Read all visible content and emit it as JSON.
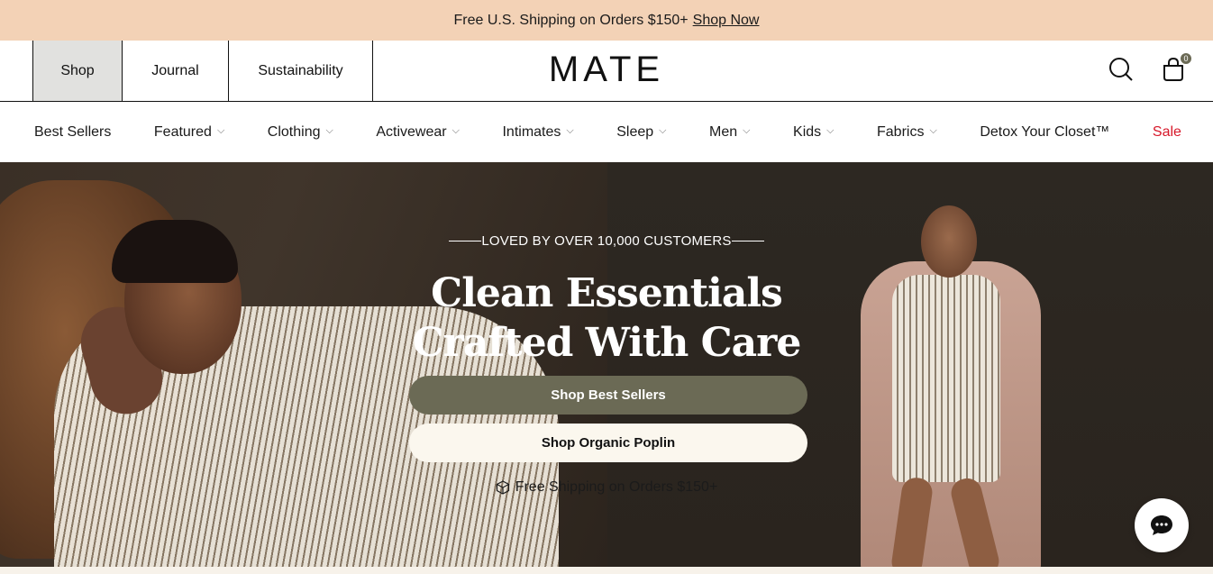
{
  "promo": {
    "text": "Free U.S. Shipping on Orders $150+",
    "link": "Shop Now"
  },
  "header": {
    "tabs": [
      "Shop",
      "Journal",
      "Sustainability"
    ],
    "logo": "MATE",
    "cart_count": "0"
  },
  "nav": {
    "items": [
      {
        "label": "Best Sellers"
      },
      {
        "label": "Featured"
      },
      {
        "label": "Clothing"
      },
      {
        "label": "Activewear"
      },
      {
        "label": "Intimates"
      },
      {
        "label": "Sleep"
      },
      {
        "label": "Men"
      },
      {
        "label": "Kids"
      },
      {
        "label": "Fabrics"
      },
      {
        "label": "Detox Your Closet™"
      },
      {
        "label": "Sale"
      }
    ]
  },
  "hero": {
    "eyebrow": "LOVED BY OVER 10,000 CUSTOMERS",
    "title_line1": "Clean Essentials",
    "title_line2": "Crafted With Care",
    "primary_button": "Shop Best Sellers",
    "secondary_button": "Shop Organic Poplin",
    "shipping_note": "Free Shipping on Orders $150+"
  },
  "colors": {
    "promo_bg": "#f3d2b6",
    "accent": "#6b6a55",
    "sale": "#d7182a"
  }
}
